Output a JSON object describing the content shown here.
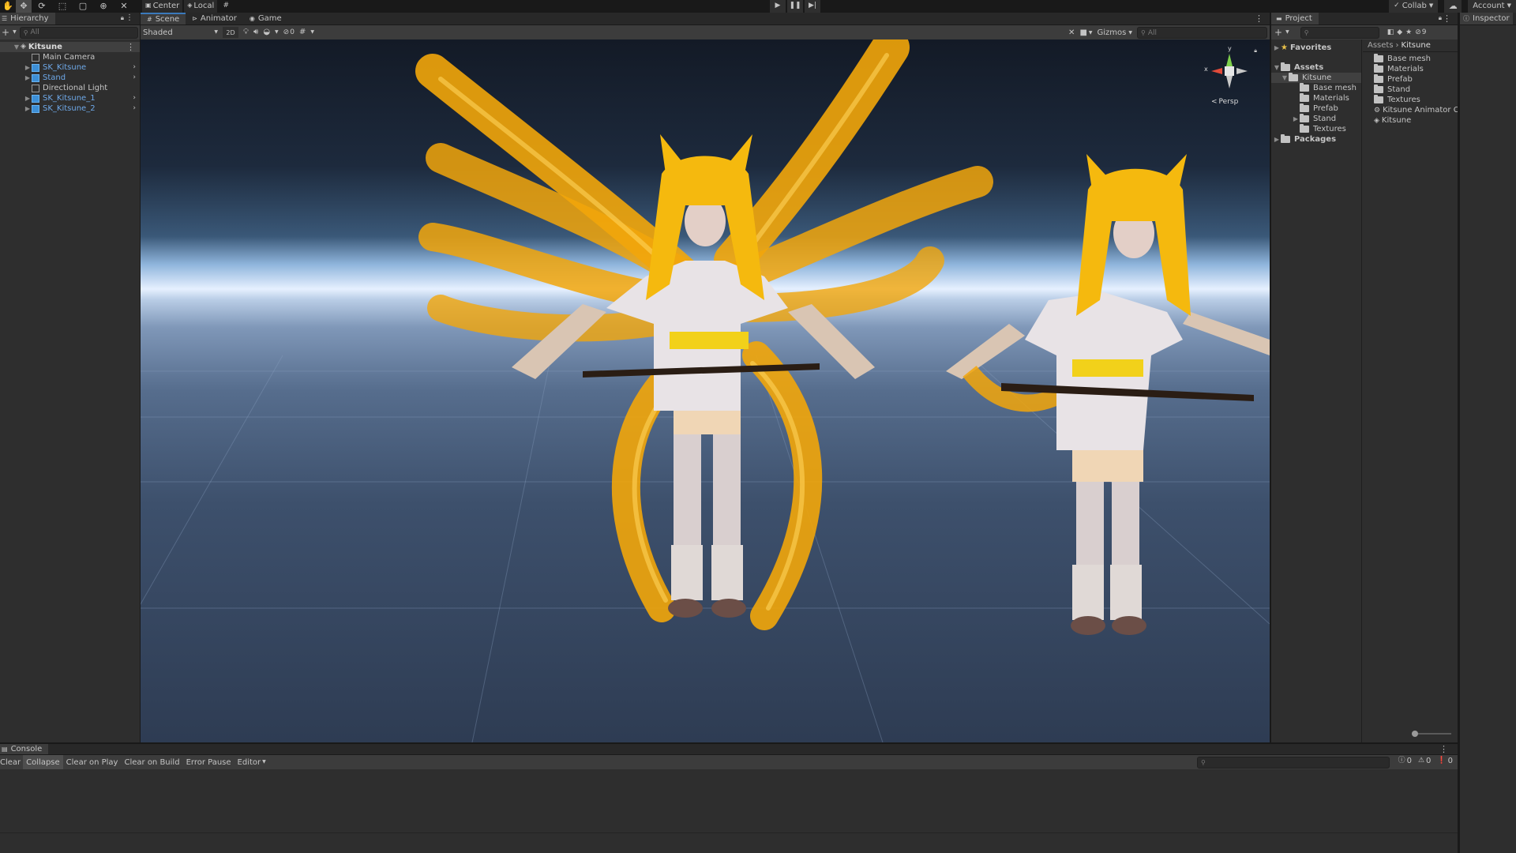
{
  "toolbar": {
    "tools": [
      "hand-tool-icon",
      "move-tool-icon",
      "rotate-tool-icon",
      "scale-tool-icon",
      "rect-tool-icon",
      "transform-tool-icon",
      "custom-tool-icon"
    ],
    "pivot_mode": "Center",
    "pivot_rotation": "Local",
    "collab_label": "Collab",
    "account_label": "Account"
  },
  "hierarchy": {
    "tab": "Hierarchy",
    "search_placeholder": "All",
    "scene": "Kitsune",
    "items": [
      {
        "label": "Main Camera",
        "prefab": false
      },
      {
        "label": "SK_Kitsune",
        "prefab": true
      },
      {
        "label": "Stand",
        "prefab": true
      },
      {
        "label": "Directional Light",
        "prefab": false
      },
      {
        "label": "SK_Kitsune_1",
        "prefab": true
      },
      {
        "label": "SK_Kitsune_2",
        "prefab": true
      }
    ]
  },
  "scene_view": {
    "tabs": [
      "Scene",
      "Animator",
      "Game"
    ],
    "shading_mode": "Shaded",
    "mode_2d": "2D",
    "hidden_count": "0",
    "gizmos_label": "Gizmos",
    "search_placeholder": "All",
    "axis_y": "y",
    "axis_x": "x",
    "projection": "Persp"
  },
  "project": {
    "tab": "Project",
    "favorites": "Favorites",
    "assets": "Assets",
    "kitsune_folder": "Kitsune",
    "subfolders": [
      "Base mesh",
      "Materials",
      "Prefab",
      "Stand",
      "Textures"
    ],
    "packages": "Packages",
    "breadcrumb": [
      "Assets",
      "Kitsune"
    ],
    "hidden_count": "9",
    "content_items": [
      {
        "label": "Base mesh",
        "kind": "folder"
      },
      {
        "label": "Materials",
        "kind": "folder"
      },
      {
        "label": "Prefab",
        "kind": "folder"
      },
      {
        "label": "Stand",
        "kind": "folder"
      },
      {
        "label": "Textures",
        "kind": "folder"
      },
      {
        "label": "Kitsune Animator Co",
        "kind": "animator"
      },
      {
        "label": "Kitsune",
        "kind": "scene"
      }
    ]
  },
  "inspector": {
    "tab": "Inspector"
  },
  "console": {
    "tab": "Console",
    "buttons": [
      "Clear",
      "Collapse",
      "Clear on Play",
      "Clear on Build",
      "Error Pause",
      "Editor"
    ],
    "counts": {
      "info": "0",
      "warning": "0",
      "error": "0"
    }
  },
  "colors": {
    "accent": "#3a79bb",
    "fur": "#f2a60a",
    "sky_horizon": "#e6f0ff",
    "ground": "#3a4a63"
  }
}
